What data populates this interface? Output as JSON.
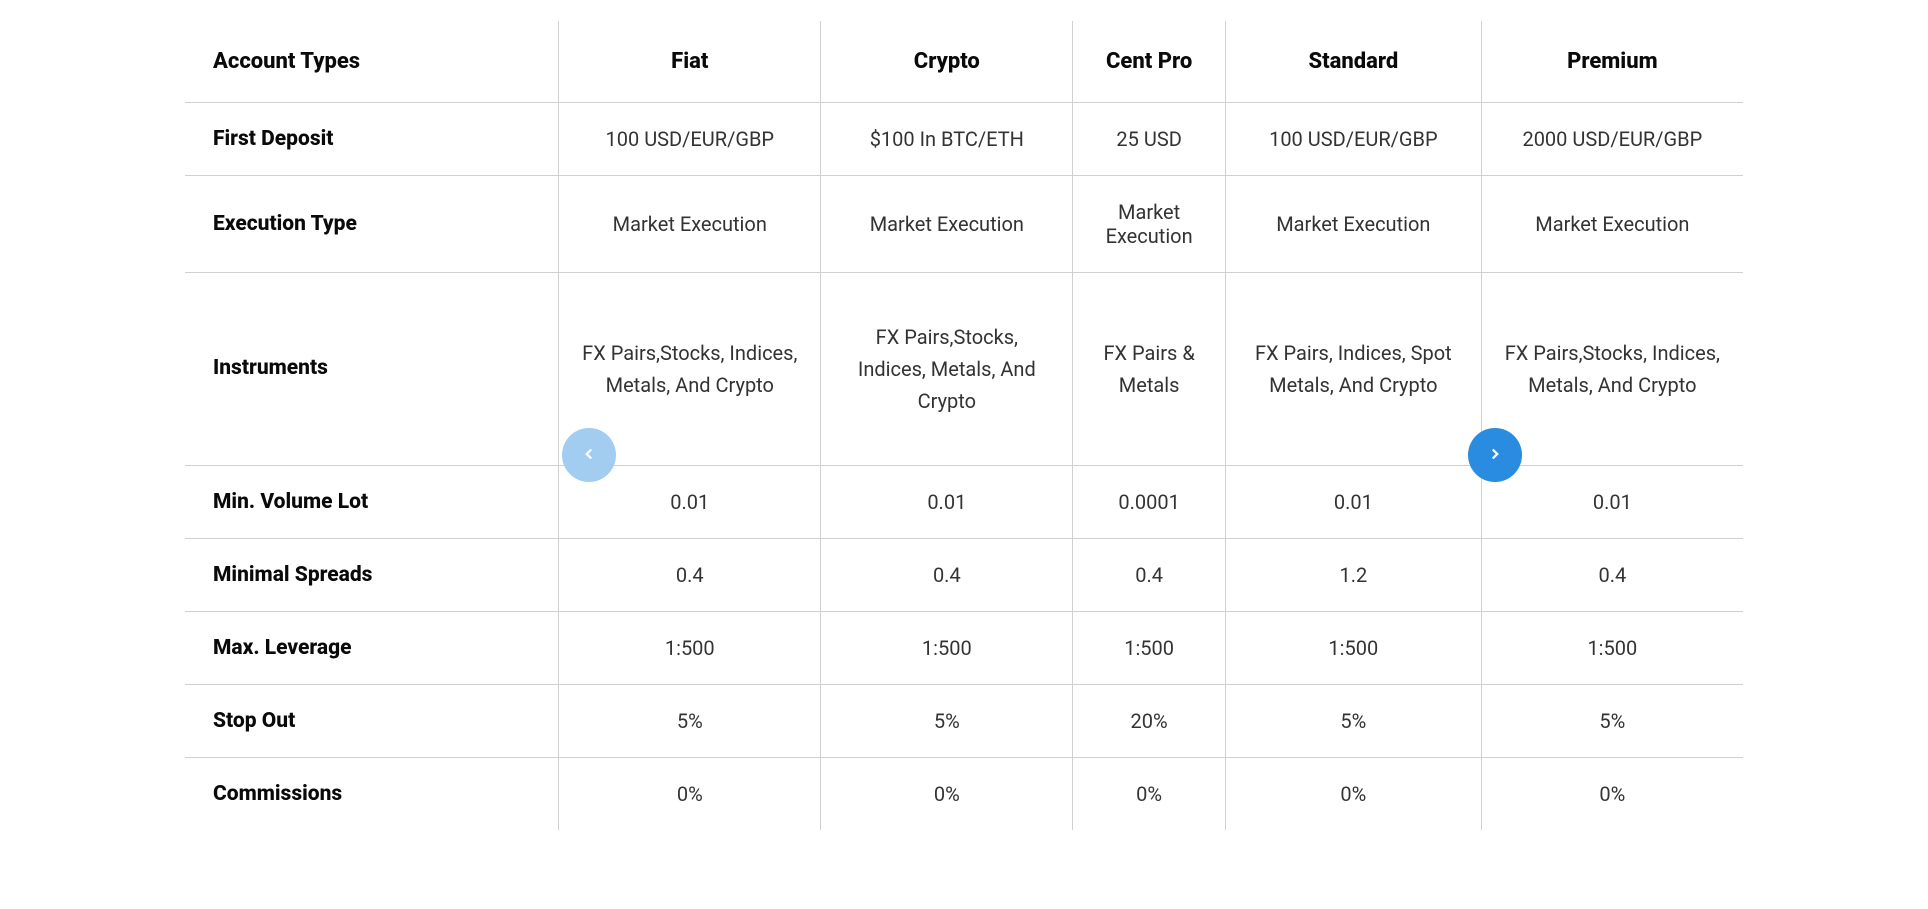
{
  "table": {
    "header_label": "Account Types",
    "columns": [
      "Fiat",
      "Crypto",
      "Cent Pro",
      "Standard",
      "Premium"
    ],
    "rows": [
      {
        "label": "First Deposit",
        "values": [
          "100 USD/EUR/GBP",
          "$100 In BTC/ETH",
          "25 USD",
          "100 USD/EUR/GBP",
          "2000 USD/EUR/GBP"
        ]
      },
      {
        "label": "Execution Type",
        "values": [
          "Market Execution",
          "Market Execution",
          "Market Execution",
          "Market Execution",
          "Market Execution"
        ]
      },
      {
        "label": "Instruments",
        "tall": true,
        "values": [
          "FX Pairs,Stocks, Indices, Metals, And Crypto",
          "FX Pairs,Stocks, Indices, Metals, And Crypto",
          "FX Pairs & Metals",
          "FX Pairs, Indices, Spot Metals, And Crypto",
          "FX Pairs,Stocks, Indices, Metals, And Crypto"
        ]
      },
      {
        "label": "Min. Volume Lot",
        "values": [
          "0.01",
          "0.01",
          "0.0001",
          "0.01",
          "0.01"
        ]
      },
      {
        "label": "Minimal Spreads",
        "values": [
          "0.4",
          "0.4",
          "0.4",
          "1.2",
          "0.4"
        ]
      },
      {
        "label": "Max. Leverage",
        "values": [
          "1:500",
          "1:500",
          "1:500",
          "1:500",
          "1:500"
        ]
      },
      {
        "label": "Stop Out",
        "values": [
          "5%",
          "5%",
          "20%",
          "5%",
          "5%"
        ]
      },
      {
        "label": "Commissions",
        "values": [
          "0%",
          "0%",
          "0%",
          "0%",
          "0%"
        ]
      }
    ]
  },
  "nav": {
    "prev_icon": "chevron-left",
    "next_icon": "chevron-right"
  }
}
